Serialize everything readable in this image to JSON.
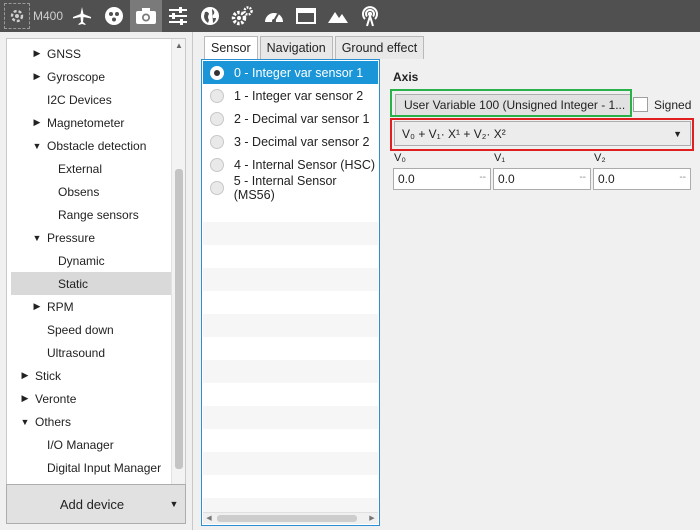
{
  "toolbar": {
    "app_label": "M400",
    "icons": [
      "airplane-icon",
      "sensors-icon",
      "camera-icon",
      "sliders-icon",
      "globe-icon",
      "gears-icon",
      "gauge-icon",
      "window-icon",
      "terrain-icon",
      "antenna-icon"
    ]
  },
  "tree": {
    "items": [
      {
        "label": "GNSS",
        "expander": "▶"
      },
      {
        "label": "Gyroscope",
        "expander": "▶"
      },
      {
        "label": "I2C Devices",
        "expander": ""
      },
      {
        "label": "Magnetometer",
        "expander": "▶"
      },
      {
        "label": "Obstacle detection",
        "expander": "▼"
      },
      {
        "label": "External",
        "expander": ""
      },
      {
        "label": "Obsens",
        "expander": ""
      },
      {
        "label": "Range sensors",
        "expander": ""
      },
      {
        "label": "Pressure",
        "expander": "▼"
      },
      {
        "label": "Dynamic",
        "expander": ""
      },
      {
        "label": "Static",
        "expander": ""
      },
      {
        "label": "RPM",
        "expander": "▶"
      },
      {
        "label": "Speed down",
        "expander": ""
      },
      {
        "label": "Ultrasound",
        "expander": ""
      },
      {
        "label": "Stick",
        "expander": "▶"
      },
      {
        "label": "Veronte",
        "expander": "▶"
      },
      {
        "label": "Others",
        "expander": "▼"
      },
      {
        "label": "I/O Manager",
        "expander": ""
      },
      {
        "label": "Digital Input Manager",
        "expander": ""
      }
    ],
    "selected": "Static"
  },
  "add_device": {
    "label": "Add device"
  },
  "tabs": [
    "Sensor",
    "Navigation",
    "Ground effect"
  ],
  "sensor_list": [
    "0 - Integer var sensor 1",
    "1 - Integer var sensor 2",
    "2 - Decimal var sensor 1",
    "3 - Decimal var sensor 2",
    "4 - Internal Sensor (HSC)",
    "5 - Internal Sensor (MS56)"
  ],
  "selected_sensor": "0 - Integer var sensor 1",
  "axis": {
    "title": "Axis",
    "variable_button": "User Variable 100 (Unsigned Integer - 1...",
    "signed_label": "Signed",
    "formula": "V₀ + V₁· X¹ + V₂· X²",
    "coeffs": [
      {
        "label": "V₀",
        "value": "0.0"
      },
      {
        "label": "V₁",
        "value": "0.0"
      },
      {
        "label": "V₂",
        "value": "0.0"
      }
    ],
    "dash": "--"
  },
  "colors": {
    "toolbar_bg": "#505050",
    "selection_blue": "#1a96d8",
    "highlight_green": "#2ab24a",
    "highlight_red": "#e02020"
  }
}
